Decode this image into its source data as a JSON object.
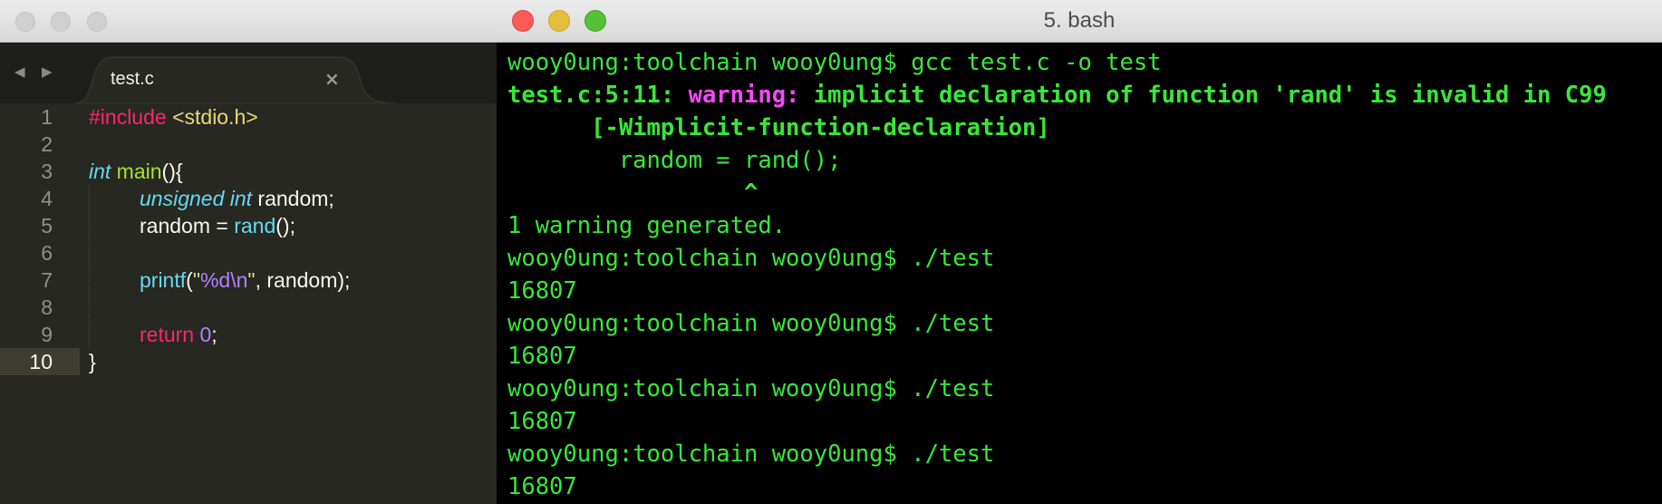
{
  "colors": {
    "terminal_fg": "#38e838",
    "warning": "#f54bf6",
    "editor_bg": "#272822",
    "terminal_bg": "#000000"
  },
  "editor": {
    "nav_back_icon": "◀",
    "nav_forward_icon": "▶",
    "tab_title": "test.c",
    "tab_close_icon": "×",
    "line_numbers": [
      "1",
      "2",
      "3",
      "4",
      "5",
      "6",
      "7",
      "8",
      "9",
      "10"
    ],
    "lines": {
      "l1_include": "#include",
      "l1_header": " <stdio.h>",
      "l3_type": "int",
      "l3_name": " main",
      "l3_rest": "(){",
      "l4_unsigned": "unsigned",
      "l4_int": " int",
      "l4_rest": " random;",
      "l5_lhs": "random = ",
      "l5_fn": "rand",
      "l5_rest": "();",
      "l7_fn": "printf",
      "l7_open": "(",
      "l7_quote1": "\"",
      "l7_fmt": "%d\\n",
      "l7_quote2": "\"",
      "l7_rest": ", random);",
      "l9_return": "return",
      "l9_num": " 0",
      "l9_semi": ";",
      "l10_brace": "}"
    }
  },
  "terminal": {
    "title": "5. bash",
    "lines": [
      "wooy0ung:toolchain wooy0ung$ gcc test.c -o test",
      "test.c:5:11: ",
      "warning:",
      " implicit declaration of function 'rand' is invalid in C99",
      "      [-Wimplicit-function-declaration]",
      "        random = rand();",
      "                 ^",
      "1 warning generated.",
      "wooy0ung:toolchain wooy0ung$ ./test",
      "16807",
      "wooy0ung:toolchain wooy0ung$ ./test",
      "16807",
      "wooy0ung:toolchain wooy0ung$ ./test",
      "16807",
      "wooy0ung:toolchain wooy0ung$ ./test",
      "16807"
    ]
  }
}
